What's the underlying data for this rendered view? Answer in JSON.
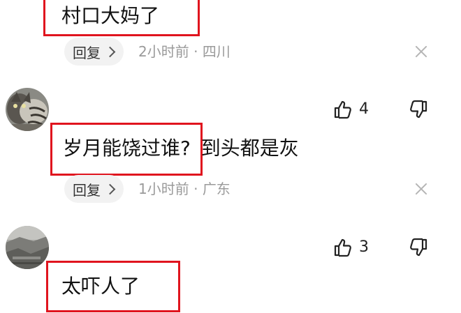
{
  "comments": [
    {
      "text_highlighted": "村口大妈了",
      "text_rest": "",
      "reply_label": "回复",
      "time": "2小时前",
      "separator": "·",
      "location": "四川"
    },
    {
      "text_highlighted": "岁月能饶过谁?",
      "text_rest": "到头都是灰",
      "reply_label": "回复",
      "time": "1小时前",
      "separator": "·",
      "location": "广东",
      "likes": "4"
    },
    {
      "text_highlighted": "太吓人了",
      "text_rest": "",
      "likes": "3"
    }
  ],
  "colors": {
    "highlight_border": "#e0141e",
    "meta_text": "#9a9a9a",
    "pill_bg": "#f2f2f2"
  },
  "icons": {
    "like": "thumbs-up-icon",
    "dislike": "thumbs-down-icon",
    "close": "close-icon",
    "reply_chevron": "chevron-right-icon"
  }
}
